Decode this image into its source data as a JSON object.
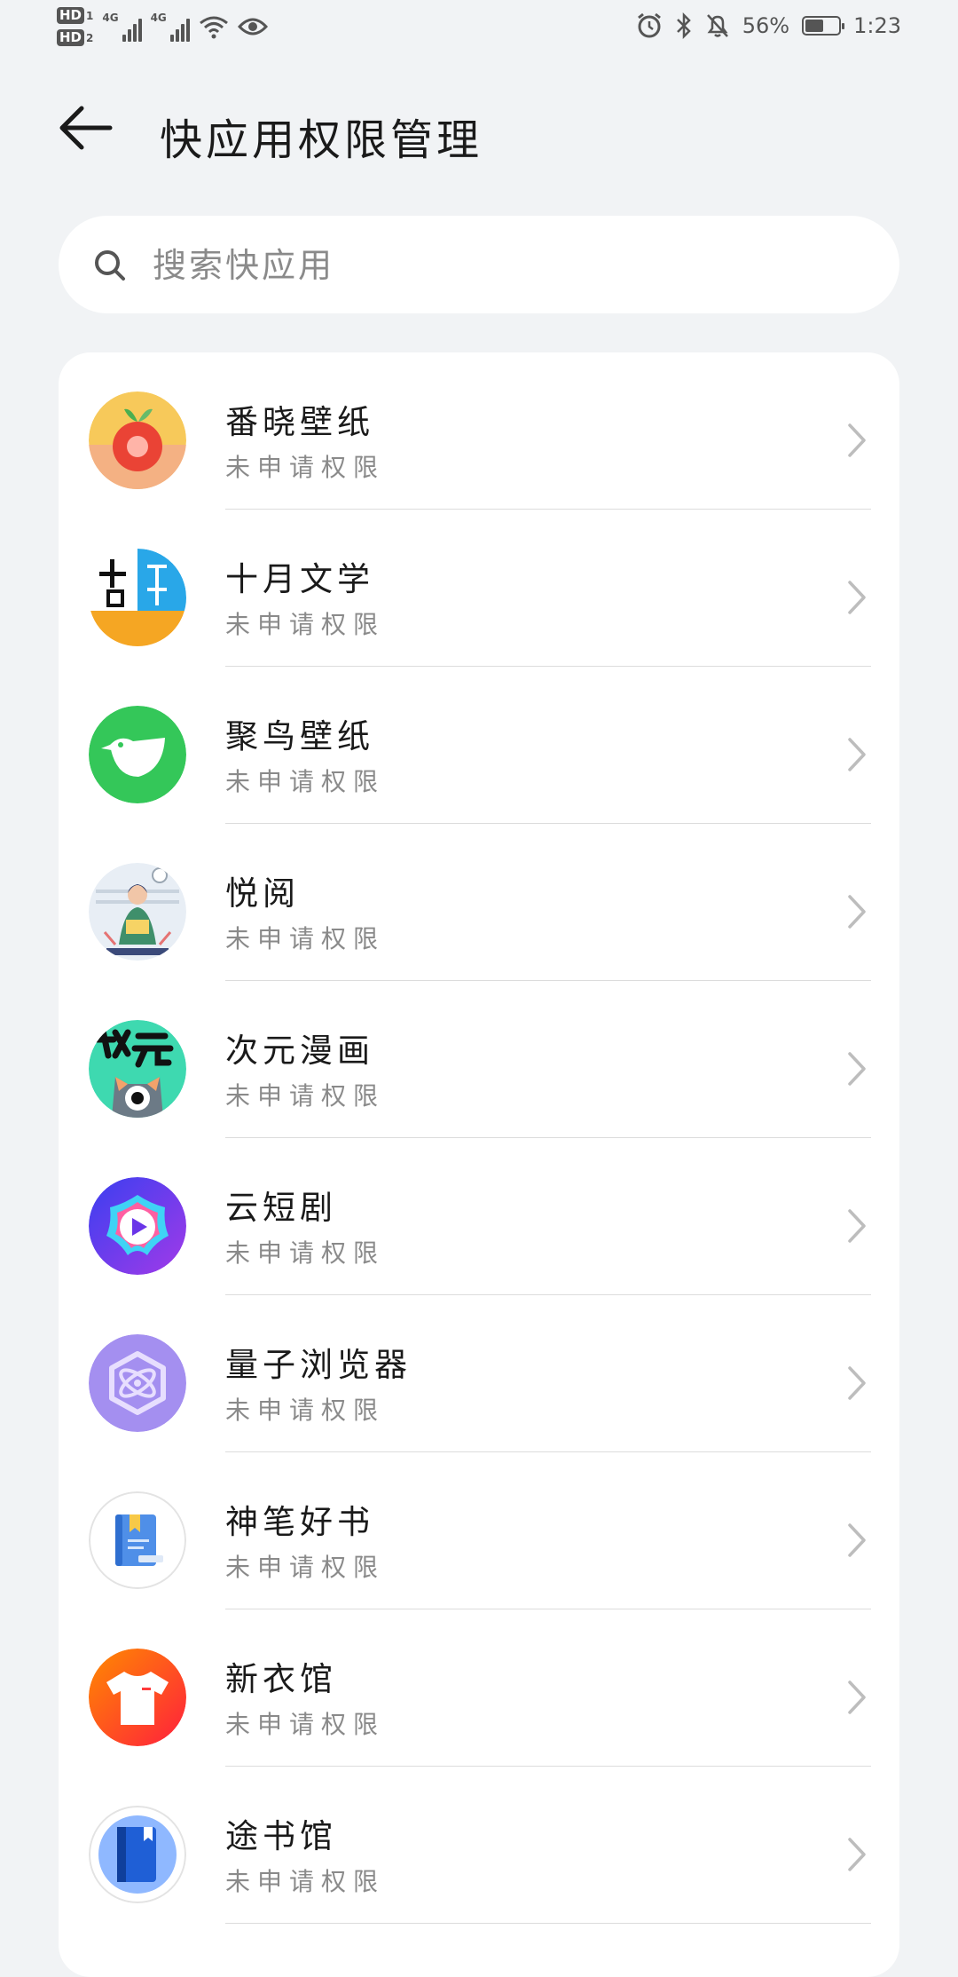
{
  "status_bar": {
    "hd1": "HD",
    "hd1_sub": "1",
    "hd2": "HD",
    "hd2_sub": "2",
    "net1": "4G",
    "net2": "4G",
    "battery_text": "56%",
    "battery_level": 0.56,
    "time": "1:23"
  },
  "header": {
    "title": "快应用权限管理"
  },
  "search": {
    "placeholder": "搜索快应用"
  },
  "apps": [
    {
      "name": "番晓壁纸",
      "status": "未申请权限",
      "icon": "fruit-icon"
    },
    {
      "name": "十月文学",
      "status": "未申请权限",
      "icon": "book-literature-icon"
    },
    {
      "name": "聚鸟壁纸",
      "status": "未申请权限",
      "icon": "bird-icon"
    },
    {
      "name": "悦阅",
      "status": "未申请权限",
      "icon": "reading-girl-icon"
    },
    {
      "name": "次元漫画",
      "status": "未申请权限",
      "icon": "cat-eye-icon"
    },
    {
      "name": "云短剧",
      "status": "未申请权限",
      "icon": "play-flower-icon"
    },
    {
      "name": "量子浏览器",
      "status": "未申请权限",
      "icon": "atom-icon"
    },
    {
      "name": "神笔好书",
      "status": "未申请权限",
      "icon": "blue-book-icon"
    },
    {
      "name": "新衣馆",
      "status": "未申请权限",
      "icon": "tshirt-icon"
    },
    {
      "name": "途书馆",
      "status": "未申请权限",
      "icon": "bookmark-book-icon"
    }
  ],
  "colors": {
    "background": "#f1f3f5",
    "card": "#ffffff",
    "secondary_text": "#8a8a8a"
  }
}
